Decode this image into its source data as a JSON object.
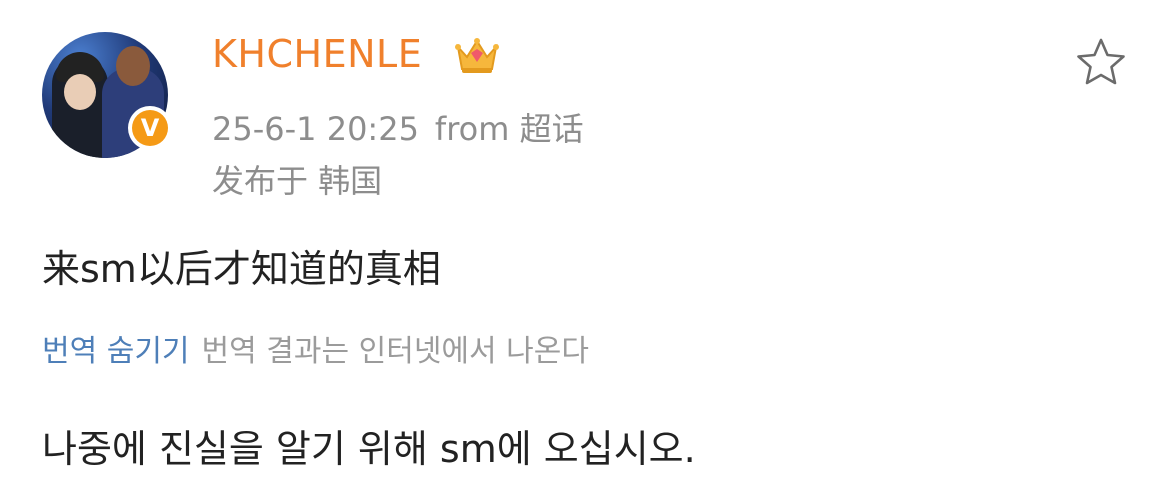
{
  "post": {
    "author": {
      "name": "KHCHENLE",
      "name_color": "#f0802c",
      "avatar_icon": "user-avatar-photo",
      "verified_icon": "verified-v-badge",
      "verified_glyph": "V",
      "badge_icon": "crown-icon"
    },
    "timestamp": "25-6-1 20:25",
    "source": "from 超话",
    "location": "发布于 韩国",
    "text": "来sm以后才知道的真相",
    "favorite_icon": "star-outline-icon"
  },
  "translation": {
    "hide_label": "번역 숨기기",
    "note": "번역 결과는 인터넷에서 나온다",
    "text": "나중에 진실을 알기 위해 sm에 오십시오."
  },
  "colors": {
    "link": "#4e7fb8",
    "meta": "#8d8d8d",
    "body": "#222222",
    "verify_badge": "#f59a16"
  }
}
